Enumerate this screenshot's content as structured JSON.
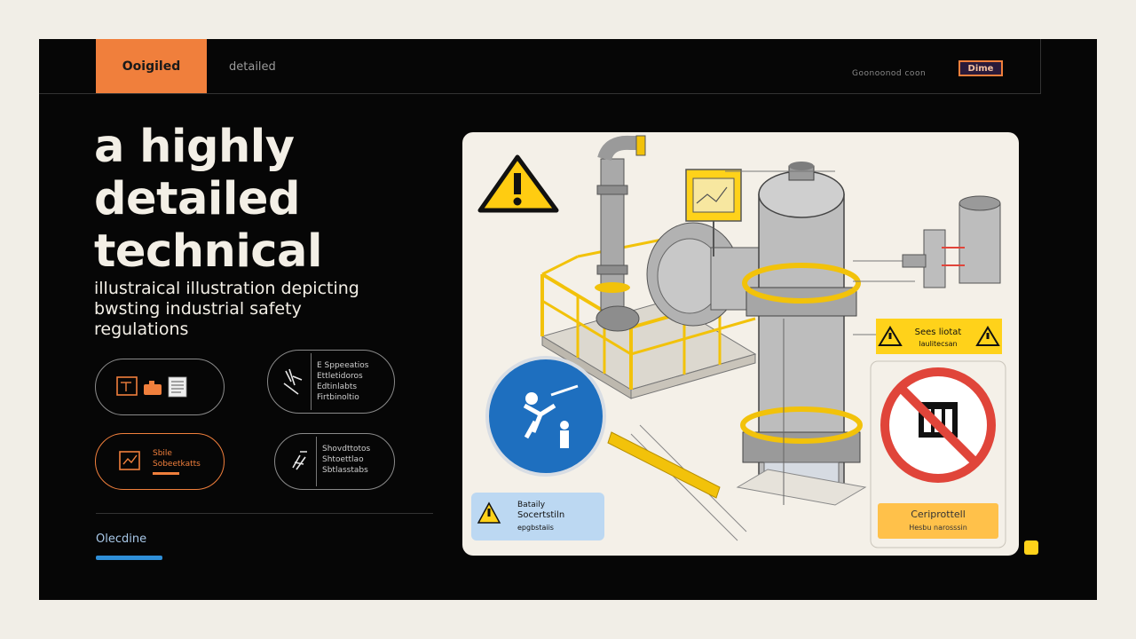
{
  "header": {
    "active_tab": "Ooigiled",
    "tab_2": "detailed",
    "meta": "Goonoonod  coon",
    "badge": "Dime"
  },
  "headline": {
    "line1": "a highly",
    "line2": "detailed",
    "line3": "technical",
    "sub1": "illustraical illustration depicting",
    "sub2": "bwsting industrial safety",
    "sub3": "regulations"
  },
  "pills": [
    {
      "lines": []
    },
    {
      "lines": [
        "E Sppeeatios",
        "Ettletidoros",
        "Edtinlabts",
        "Firtbinoltio"
      ]
    },
    {
      "lines": [
        "Sbile",
        "Sobeetkatts"
      ]
    },
    {
      "lines": [
        "Shovdttotos",
        "Shtoettlao",
        "Sbtlasstabs"
      ]
    }
  ],
  "footer": {
    "label": "Olecdine"
  },
  "card": {
    "warn_label_1": "Sees liotat",
    "warn_label_2": "laulitecsan",
    "blue_label_1": "Bataily",
    "blue_label_2": "Socertstiln",
    "blue_label_3": "epgbstaiis",
    "orange_label_1": "Ceriprottell",
    "orange_label_2": "Hesbu narosssin"
  },
  "colors": {
    "accent": "#f07f3c",
    "background": "#060606",
    "card": "#f4f0e8",
    "safety_yellow": "#ffd21a",
    "sign_blue": "#1e6fbf",
    "prohibition_red": "#e0453a"
  }
}
